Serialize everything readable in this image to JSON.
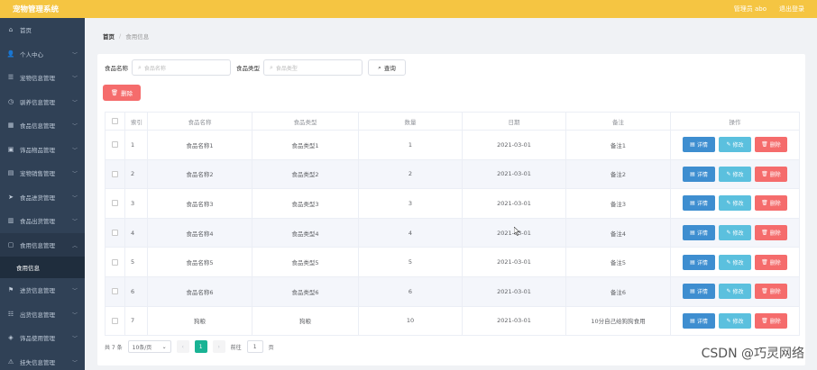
{
  "header": {
    "app_title": "宠物管理系统",
    "role_user": "管理员 abo",
    "logout": "退出登录"
  },
  "sidebar": {
    "items": [
      {
        "label": "首页",
        "icon": "home-icon",
        "glyph": "⌂",
        "has_arrow": false
      },
      {
        "label": "个人中心",
        "icon": "user-icon",
        "glyph": "👤",
        "has_arrow": true
      },
      {
        "label": "宠物信息管理",
        "icon": "list-icon",
        "glyph": "☰",
        "has_arrow": true
      },
      {
        "label": "驯养信息管理",
        "icon": "clock-icon",
        "glyph": "◷",
        "has_arrow": true
      },
      {
        "label": "食品信息管理",
        "icon": "grid-icon",
        "glyph": "▦",
        "has_arrow": true
      },
      {
        "label": "饰品物品管理",
        "icon": "bag-icon",
        "glyph": "▣",
        "has_arrow": true
      },
      {
        "label": "宠物销售管理",
        "icon": "chart-icon",
        "glyph": "▤",
        "has_arrow": true
      },
      {
        "label": "食品进货管理",
        "icon": "send-icon",
        "glyph": "➤",
        "has_arrow": true
      },
      {
        "label": "食品出货管理",
        "icon": "box-icon",
        "glyph": "▥",
        "has_arrow": true
      },
      {
        "label": "食用信息管理",
        "icon": "doc-icon",
        "glyph": "▢",
        "has_arrow": true,
        "expanded": true
      }
    ],
    "submenu": "食用信息",
    "items_after": [
      {
        "label": "进货信息管理",
        "icon": "flag-icon",
        "glyph": "⚑",
        "has_arrow": true
      },
      {
        "label": "出货信息管理",
        "icon": "bars-icon",
        "glyph": "☷",
        "has_arrow": true
      },
      {
        "label": "饰品使用管理",
        "icon": "tag-icon",
        "glyph": "◈",
        "has_arrow": true
      },
      {
        "label": "挂失信息管理",
        "icon": "warn-icon",
        "glyph": "⚠",
        "has_arrow": true
      }
    ]
  },
  "breadcrumb": {
    "home": "首页",
    "separator": "/",
    "current": "食用信息"
  },
  "search": {
    "name_label": "食品名称",
    "name_placeholder": "食品名称",
    "type_label": "食品类型",
    "type_placeholder": "食品类型",
    "search_button": "查询"
  },
  "bulk_delete": "删除",
  "table": {
    "headers": [
      "",
      "索引",
      "食品名称",
      "食品类型",
      "数量",
      "日期",
      "备注",
      "操作"
    ],
    "rows": [
      [
        "1",
        "食品名称1",
        "食品类型1",
        "1",
        "2021-03-01",
        "备注1"
      ],
      [
        "2",
        "食品名称2",
        "食品类型2",
        "2",
        "2021-03-01",
        "备注2"
      ],
      [
        "3",
        "食品名称3",
        "食品类型3",
        "3",
        "2021-03-01",
        "备注3"
      ],
      [
        "4",
        "食品名称4",
        "食品类型4",
        "4",
        "2021-03-01",
        "备注4"
      ],
      [
        "5",
        "食品名称5",
        "食品类型5",
        "5",
        "2021-03-01",
        "备注5"
      ],
      [
        "6",
        "食品名称6",
        "食品类型6",
        "6",
        "2021-03-01",
        "备注6"
      ],
      [
        "7",
        "狗粮",
        "狗粮",
        "10",
        "2021-03-01",
        "10分自己给狗狗食用"
      ]
    ],
    "ops": {
      "detail": "详情",
      "edit": "修改",
      "delete": "删除"
    }
  },
  "pagination": {
    "total": "共 7 条",
    "page_size": "10条/页",
    "prev": "‹",
    "current_page": "1",
    "next": "›",
    "goto_label": "前往",
    "goto_value": "1",
    "page_suffix": "页"
  },
  "watermark": "CSDN @巧灵网络",
  "colors": {
    "header": "#f5c542",
    "sidebar": "#304156",
    "detail": "#3e8ed0",
    "edit": "#5bc0de",
    "delete": "#f56c6c",
    "page_active": "#19b394"
  }
}
